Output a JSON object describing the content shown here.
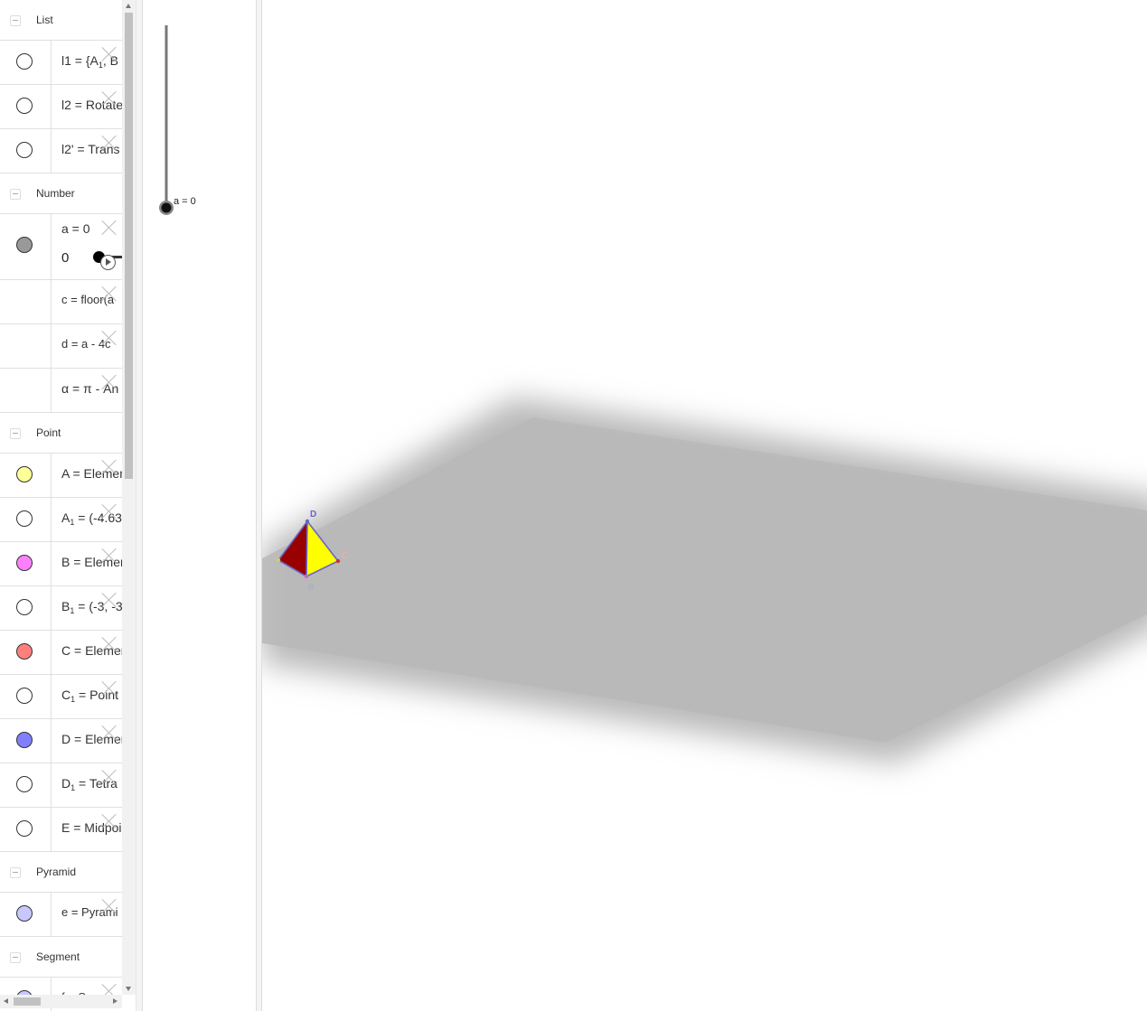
{
  "algebra": {
    "groups": [
      {
        "name": "List"
      },
      {
        "name": "Number"
      },
      {
        "name": "Point"
      },
      {
        "name": "Pyramid"
      },
      {
        "name": "Segment"
      }
    ],
    "list": [
      {
        "prefix": "l1 = {A",
        "sub": "1",
        "suffix": ", B"
      },
      {
        "text": "l2 = Rotate"
      },
      {
        "text": "l2' = Trans"
      }
    ],
    "number": {
      "slider_def": "a = 0",
      "slider_value": "0",
      "items": [
        {
          "text": "c = floor(a"
        },
        {
          "text": "d = a - 4c"
        },
        {
          "text": "α = π - An"
        }
      ]
    },
    "points": [
      {
        "prefix": "A = Elemen",
        "color": "#ffff99"
      },
      {
        "prefix": "A",
        "sub": "1",
        "suffix": " = (-4.63",
        "color": "#ffffff"
      },
      {
        "prefix": "B = Elemen",
        "color": "#ff80ff"
      },
      {
        "prefix": "B",
        "sub": "1",
        "suffix": " = (-3, -3",
        "color": "#ffffff"
      },
      {
        "prefix": "C = Elemen",
        "color": "#ff7f7f"
      },
      {
        "prefix": "C",
        "sub": "1",
        "suffix": " = Point",
        "color": "#ffffff"
      },
      {
        "prefix": "D = Elemen",
        "color": "#8080ff"
      },
      {
        "prefix": "D",
        "sub": "1",
        "suffix": " = Tetra",
        "color": "#ffffff"
      },
      {
        "prefix": "E = Midpoi",
        "color": "#ffffff"
      }
    ],
    "pyramid": [
      {
        "text": "e = Pyrami",
        "color": "#c8c8ff"
      }
    ],
    "segment": [
      {
        "text": "f = Segm",
        "color": "#c8c8ff"
      }
    ]
  },
  "graphics2d": {
    "slider_label": "a = 0"
  },
  "graphics3d": {
    "points": {
      "A": "A",
      "B": "B",
      "C": "C",
      "D": "D"
    },
    "colors": {
      "plane": "#b9b9b9",
      "face_left": "#990000",
      "face_right": "#ffff00",
      "edges": "#6666cc"
    }
  }
}
